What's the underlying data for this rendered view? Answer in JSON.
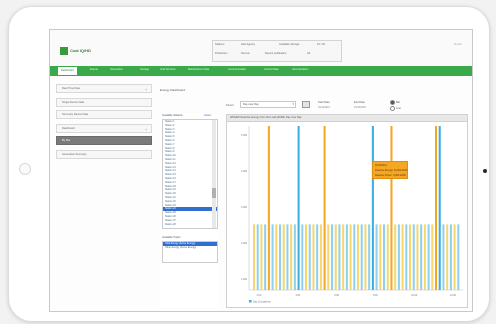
{
  "app": {
    "name": "Coal IQ/HD"
  },
  "header": {
    "station_label": "Stations",
    "station_value": "Harl Agency",
    "available_label": "Available Storage",
    "available_value": "10 / 30",
    "production_label": "Production",
    "production_value": "Normal",
    "published_label": "Recent publication",
    "published_value": "4/1",
    "link": "Email"
  },
  "nav": {
    "tabs": [
      {
        "label": "Dashboard",
        "active": true
      },
      {
        "label": "Events"
      },
      {
        "label": "Generation"
      },
      {
        "label": "Storage"
      },
      {
        "label": "Grid Services"
      },
      {
        "label": "Maintenance Data"
      },
      {
        "label": "Communication"
      },
      {
        "label": "Control Data"
      },
      {
        "label": "Administration"
      }
    ]
  },
  "sidebar": {
    "items": [
      {
        "label": "Real Time Data",
        "chevron": "⌄"
      },
      {
        "label": "Single Device Data"
      },
      {
        "label": "Summary Device Data"
      },
      {
        "label": "Dashboard",
        "chevron": "⌄"
      },
      {
        "label": "By Site",
        "active": true
      },
      {
        "label": "Generation Summary"
      }
    ]
  },
  "main": {
    "title": "Energy Dashboard",
    "period_label": "Period",
    "period_value": "Day over Day",
    "stats": [
      {
        "label": "Start Date",
        "value": "01/11/2015"
      },
      {
        "label": "End Date",
        "value": "01/15/2015"
      }
    ],
    "view_options": [
      {
        "label": "Bar",
        "checked": true
      },
      {
        "label": "Line",
        "checked": false
      }
    ]
  },
  "stations_list": {
    "header": "Available Stations",
    "link": "Select",
    "items": [
      "Station 1",
      "Station 2",
      "Station 3",
      "Station 4",
      "Station 5",
      "Station 6",
      "Station 7",
      "Station 8",
      "Station 9",
      "Station 10",
      "Station 11",
      "Station 12",
      "Station 13",
      "Station 14",
      "Station 15",
      "Station 16",
      "Station 17",
      "Station 18",
      "Station 19",
      "Station 20",
      "Station 21",
      "Station 22",
      "Station 23",
      "Station 24",
      "Station 25",
      "Station 26",
      "Station 27",
      "Station 28"
    ],
    "selected_index": 23
  },
  "topics_list": {
    "header": "Available Topics",
    "items": [
      "Total Energy (Active Energy)",
      "Other Energy (Active Energy)"
    ],
    "selected_index": 0
  },
  "chart": {
    "title": "Wh/kWh Reactive Energy from the Load (kVAR) Day over Day"
  },
  "tooltip": {
    "lines": [
      "11/26/2014",
      "Reactive Energy: 10,000 kVAh",
      "Reactive Power: 4,000 kVAR"
    ]
  },
  "chart_data": {
    "type": "bar",
    "title": "Wh/kWh Reactive Energy from the Load (kVAR) Day over Day",
    "ylim": [
      0,
      5000
    ],
    "yticks": [
      "5,000",
      "4,000",
      "3,000",
      "2,000",
      "1,000"
    ],
    "xticks": [
      "2:00",
      "4:00",
      "6:00",
      "8:00",
      "10:00",
      "12:00"
    ],
    "grid": false,
    "colors": {
      "orange": "#f5a623",
      "blue": "#3aaee0",
      "yellow": "#f5d76e",
      "lightblue": "#8fd0ee"
    },
    "bars_orange_index": [
      4,
      19,
      37,
      49
    ],
    "bars_blue_index": [
      12,
      32,
      50
    ],
    "value_tall": 5000,
    "value_short": 2000,
    "legend": [
      {
        "name": "Day Comparison"
      }
    ]
  }
}
